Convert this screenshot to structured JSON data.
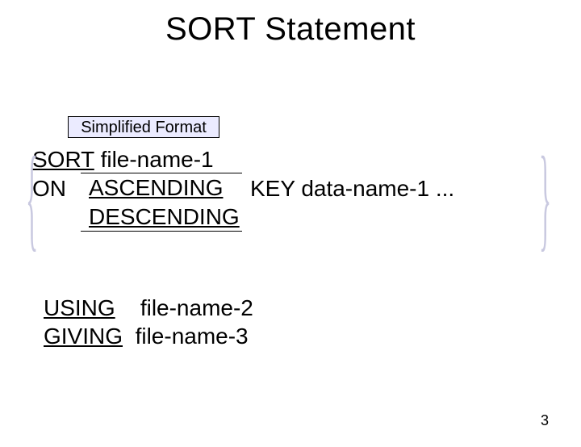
{
  "title": "SORT Statement",
  "format_label": "Simplified Format",
  "sort": {
    "keyword": "SORT",
    "file1": "file-name-1",
    "on": "ON",
    "ascending": "ASCENDING",
    "descending": "DESCENDING",
    "key": "KEY",
    "data1": "data-name-1",
    "ellipsis": "..."
  },
  "using": {
    "using_kw": "USING",
    "file2": "file-name-2",
    "giving_kw": "GIVING",
    "file3": "file-name-3"
  },
  "braces": {
    "left": "{",
    "right": "}"
  },
  "page_number": "3"
}
